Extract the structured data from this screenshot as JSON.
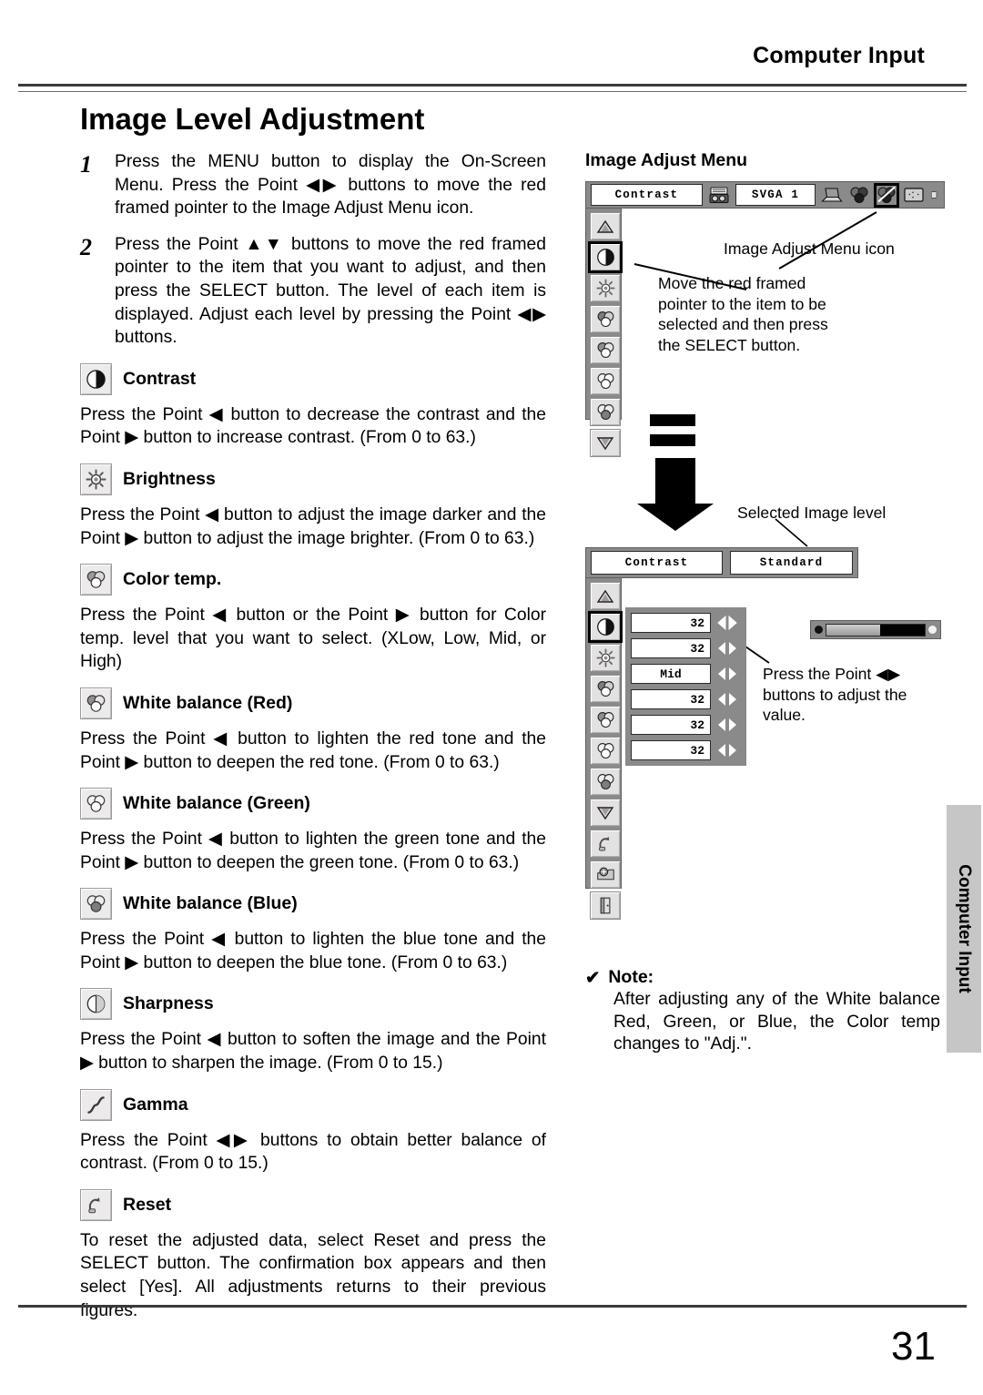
{
  "header": {
    "title": "Computer Input"
  },
  "page_title": "Image Level Adjustment",
  "page_number": "31",
  "side_tab": {
    "label": "Computer Input"
  },
  "steps": [
    {
      "num": "1",
      "text": "Press the MENU button to display the On-Screen Menu.  Press the Point ◀▶ buttons to move the red framed pointer to the Image Adjust Menu icon."
    },
    {
      "num": "2",
      "text": "Press the Point ▲▼ buttons to move the red framed pointer to the item that you want to adjust, and then press the SELECT button.  The level of each item is displayed.  Adjust each level by pressing the Point ◀▶ buttons."
    }
  ],
  "sections": [
    {
      "icon": "contrast-icon",
      "title": "Contrast",
      "body": "Press the Point ◀ button to decrease the contrast and the Point ▶ button to increase contrast. (From 0 to 63.)"
    },
    {
      "icon": "brightness-icon",
      "title": "Brightness",
      "body": "Press the Point ◀ button to adjust the image darker and the Point ▶ button to adjust the image brighter. (From 0 to 63.)"
    },
    {
      "icon": "color-temp-icon",
      "title": "Color temp.",
      "body": "Press the Point ◀ button or the Point ▶ button for Color temp. level that you want to select. (XLow, Low, Mid, or High)"
    },
    {
      "icon": "white-balance-red-icon",
      "title": "White balance (Red)",
      "body": "Press the Point ◀ button to lighten the red tone and the Point ▶ button to deepen the red tone. (From 0 to 63.)"
    },
    {
      "icon": "white-balance-green-icon",
      "title": "White balance (Green)",
      "body": "Press the Point ◀ button to lighten the green tone and the Point ▶ button to deepen the green tone. (From 0 to 63.)"
    },
    {
      "icon": "white-balance-blue-icon",
      "title": "White balance (Blue)",
      "body": "Press the Point ◀ button to lighten the blue tone and the Point ▶ button to deepen the blue tone. (From 0 to 63.)"
    },
    {
      "icon": "sharpness-icon",
      "title": "Sharpness",
      "body": "Press the Point ◀ button to soften the image and the Point ▶ button to sharpen the image. (From 0 to 15.)"
    },
    {
      "icon": "gamma-icon",
      "title": "Gamma",
      "body": "Press the Point ◀▶ buttons to obtain better balance of contrast. (From 0 to 15.)"
    },
    {
      "icon": "reset-icon",
      "title": "Reset",
      "body": "To reset the adjusted data, select Reset and press the SELECT button.  The confirmation box appears and then select [Yes].  All adjustments returns to their previous figures."
    }
  ],
  "right": {
    "heading": "Image Adjust Menu",
    "menu_top": {
      "item_label": "Contrast",
      "source_label": "SVGA 1",
      "top_icons": [
        "system-icon",
        "computer-icon",
        "image-select-icon",
        "image-adjust-icon",
        "screen-icon",
        "setting-icon"
      ],
      "selected_top_icon": "image-adjust-icon",
      "side_icons": [
        "scroll-up-icon",
        "contrast-icon",
        "brightness-icon",
        "color-temp-icon",
        "white-balance-red-icon",
        "white-balance-green-icon",
        "white-balance-blue-icon",
        "scroll-down-icon"
      ],
      "selected_side_icon": "contrast-icon"
    },
    "menu_bottom": {
      "item_label": "Contrast",
      "level_label": "Standard",
      "values": [
        "32",
        "32",
        "Mid",
        "32",
        "32",
        "32"
      ],
      "slider_percent": 55,
      "side_icons_top": [
        "scroll-up-icon",
        "contrast-icon",
        "brightness-icon",
        "color-temp-icon",
        "white-balance-red-icon",
        "white-balance-green-icon",
        "white-balance-blue-icon"
      ],
      "side_icons_bottom": [
        "scroll-down-icon",
        "reset-icon",
        "store-icon",
        "quit-icon"
      ],
      "selected_side_icon": "contrast-icon"
    },
    "callouts": {
      "menu_icon": "Image Adjust Menu icon",
      "move_pointer": "Move the red framed\npointer to the item to be\nselected and then press\nthe SELECT button.",
      "selected_level": "Selected Image level",
      "adjust_value": "Press the Point ◀▶\nbuttons to adjust the\nvalue."
    }
  },
  "note": {
    "check": "✔",
    "label": "Note:",
    "body": "After adjusting any of the White balance Red, Green, or Blue, the Color temp changes to \"Adj.\"."
  },
  "colors": {
    "osd_gray": "#8a8a8a",
    "tab_gray": "#c6c6c6",
    "rule": "#3a3a3a"
  }
}
